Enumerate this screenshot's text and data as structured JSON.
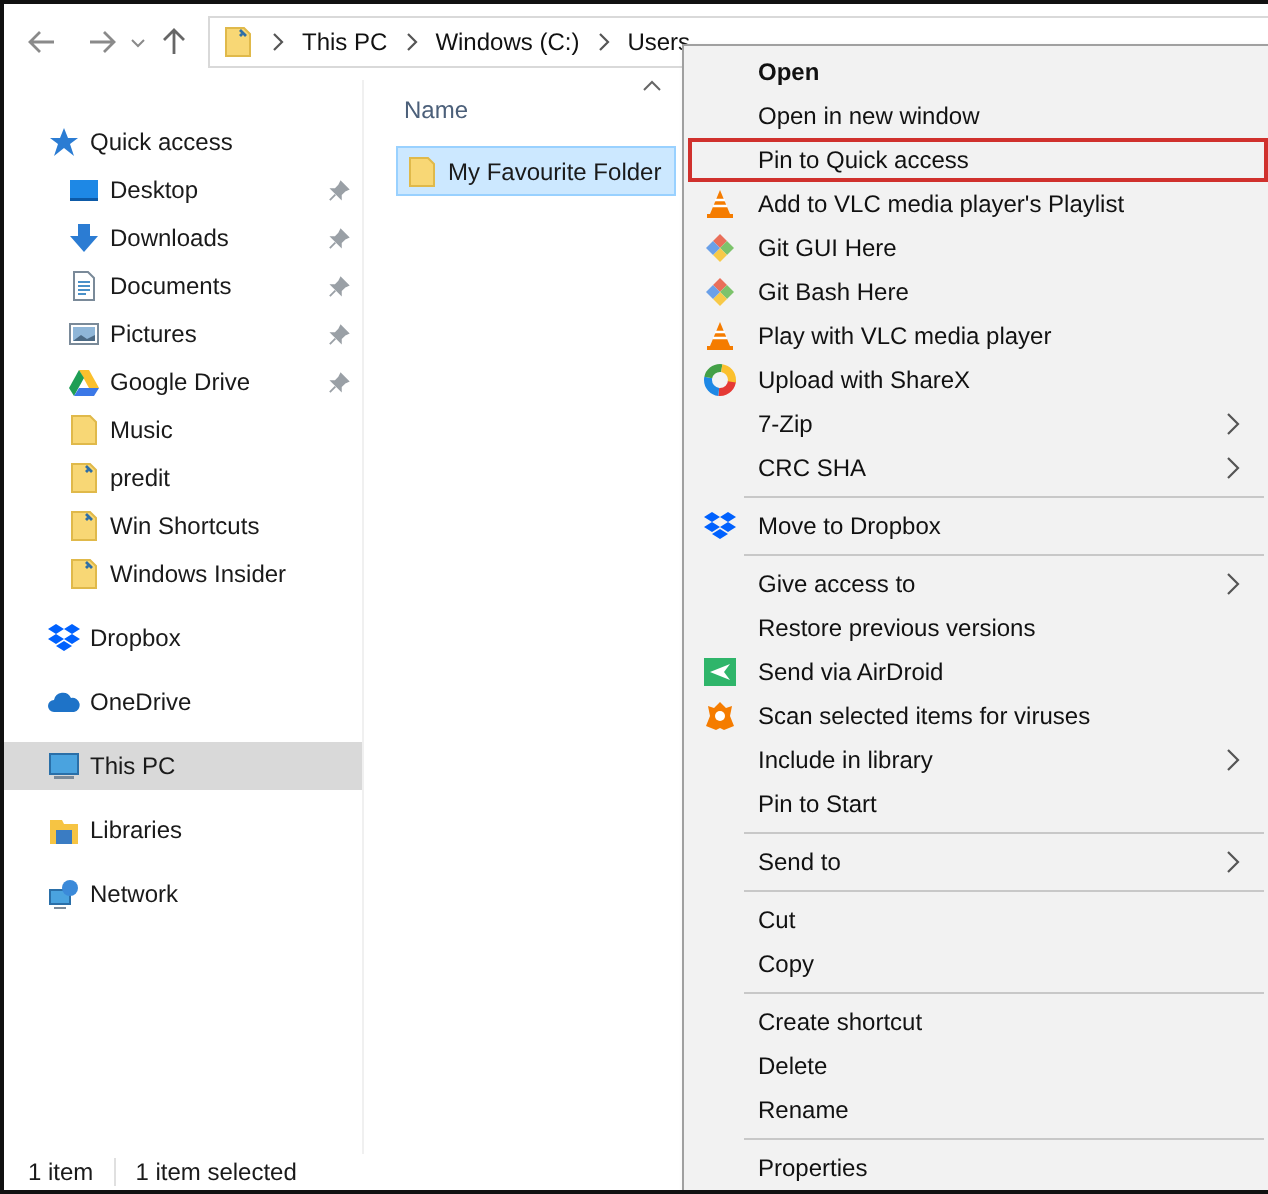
{
  "address_bar": {
    "crumbs": [
      "This PC",
      "Windows (C:)",
      "Users"
    ]
  },
  "sidebar": {
    "items": [
      {
        "label": "Quick access",
        "kind": "star",
        "selected": false,
        "pinned": false,
        "children": [
          {
            "label": "Desktop",
            "kind": "desktop",
            "selected": false,
            "pinned": true
          },
          {
            "label": "Downloads",
            "kind": "download",
            "selected": false,
            "pinned": true
          },
          {
            "label": "Documents",
            "kind": "document",
            "selected": false,
            "pinned": true
          },
          {
            "label": "Pictures",
            "kind": "pictures",
            "selected": false,
            "pinned": true
          },
          {
            "label": "Google Drive",
            "kind": "drive",
            "selected": false,
            "pinned": true
          },
          {
            "label": "Music",
            "kind": "folder",
            "selected": false,
            "pinned": false
          },
          {
            "label": "predit",
            "kind": "shortcut-folder",
            "selected": false,
            "pinned": false
          },
          {
            "label": "Win Shortcuts",
            "kind": "shortcut-folder",
            "selected": false,
            "pinned": false
          },
          {
            "label": "Windows Insider",
            "kind": "shortcut-folder",
            "selected": false,
            "pinned": false
          }
        ]
      },
      {
        "label": "Dropbox",
        "kind": "dropbox",
        "selected": false,
        "pinned": false
      },
      {
        "label": "OneDrive",
        "kind": "cloud",
        "selected": false,
        "pinned": false
      },
      {
        "label": "This PC",
        "kind": "computer",
        "selected": true,
        "pinned": false
      },
      {
        "label": "Libraries",
        "kind": "library",
        "selected": false,
        "pinned": false
      },
      {
        "label": "Network",
        "kind": "network",
        "selected": false,
        "pinned": false
      }
    ]
  },
  "file_list": {
    "columns": [
      "Name"
    ],
    "files": [
      {
        "name": "My Favourite Folder",
        "selected": true
      }
    ]
  },
  "context_menu": {
    "items": [
      {
        "kind": "item",
        "label": "Open",
        "bold": true,
        "highlighted": false,
        "submenu": false
      },
      {
        "kind": "item",
        "label": "Open in new window",
        "bold": false,
        "highlighted": false,
        "submenu": false
      },
      {
        "kind": "item",
        "label": "Pin to Quick access",
        "bold": false,
        "highlighted": true,
        "submenu": false
      },
      {
        "kind": "cone",
        "label": "Add to VLC media player's Playlist",
        "bold": false,
        "highlighted": false,
        "submenu": false
      },
      {
        "kind": "diamond",
        "label": "Git GUI Here",
        "bold": false,
        "highlighted": false,
        "submenu": false
      },
      {
        "kind": "diamond",
        "label": "Git Bash Here",
        "bold": false,
        "highlighted": false,
        "submenu": false
      },
      {
        "kind": "cone",
        "label": "Play with VLC media player",
        "bold": false,
        "highlighted": false,
        "submenu": false
      },
      {
        "kind": "ring",
        "label": "Upload with ShareX",
        "bold": false,
        "highlighted": false,
        "submenu": false
      },
      {
        "kind": "item",
        "label": "7-Zip",
        "bold": false,
        "highlighted": false,
        "submenu": true
      },
      {
        "kind": "item",
        "label": "CRC SHA",
        "bold": false,
        "highlighted": false,
        "submenu": true
      },
      {
        "kind": "separator"
      },
      {
        "kind": "dropbox",
        "label": "Move to Dropbox",
        "bold": false,
        "highlighted": false,
        "submenu": false
      },
      {
        "kind": "separator"
      },
      {
        "kind": "item",
        "label": "Give access to",
        "bold": false,
        "highlighted": false,
        "submenu": true
      },
      {
        "kind": "item",
        "label": "Restore previous versions",
        "bold": false,
        "highlighted": false,
        "submenu": false
      },
      {
        "kind": "paper-plane",
        "label": "Send via AirDroid",
        "bold": false,
        "highlighted": false,
        "submenu": false
      },
      {
        "kind": "shield",
        "label": "Scan selected items for viruses",
        "bold": false,
        "highlighted": false,
        "submenu": false
      },
      {
        "kind": "item",
        "label": "Include in library",
        "bold": false,
        "highlighted": false,
        "submenu": true
      },
      {
        "kind": "item",
        "label": "Pin to Start",
        "bold": false,
        "highlighted": false,
        "submenu": false
      },
      {
        "kind": "separator"
      },
      {
        "kind": "item",
        "label": "Send to",
        "bold": false,
        "highlighted": false,
        "submenu": true
      },
      {
        "kind": "separator"
      },
      {
        "kind": "item",
        "label": "Cut",
        "bold": false,
        "highlighted": false,
        "submenu": false
      },
      {
        "kind": "item",
        "label": "Copy",
        "bold": false,
        "highlighted": false,
        "submenu": false
      },
      {
        "kind": "separator"
      },
      {
        "kind": "item",
        "label": "Create shortcut",
        "bold": false,
        "highlighted": false,
        "submenu": false
      },
      {
        "kind": "item",
        "label": "Delete",
        "bold": false,
        "highlighted": false,
        "submenu": false
      },
      {
        "kind": "item",
        "label": "Rename",
        "bold": false,
        "highlighted": false,
        "submenu": false
      },
      {
        "kind": "separator"
      },
      {
        "kind": "item",
        "label": "Properties",
        "bold": false,
        "highlighted": false,
        "submenu": false
      }
    ]
  },
  "status_bar": {
    "items": [
      "1 item",
      "1 item selected"
    ]
  }
}
